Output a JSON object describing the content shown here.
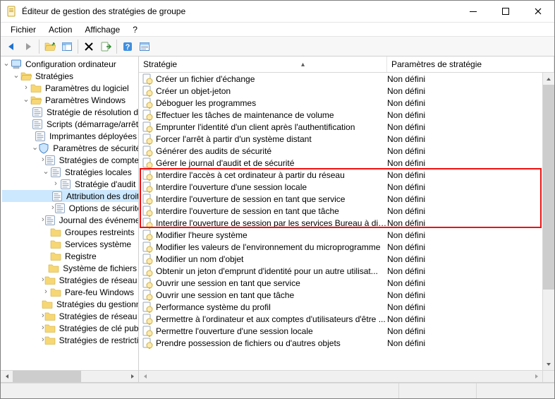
{
  "window": {
    "title": "Éditeur de gestion des stratégies de groupe"
  },
  "menu": {
    "file": "Fichier",
    "action": "Action",
    "view": "Affichage",
    "help": "?"
  },
  "columns": {
    "policy": "Stratégie",
    "setting": "Paramètres de stratégie"
  },
  "tree": {
    "root": {
      "label": "Configuration ordinateur"
    },
    "n1": {
      "label": "Stratégies"
    },
    "n1a": {
      "label": "Paramètres du logiciel"
    },
    "n1b": {
      "label": "Paramètres Windows"
    },
    "n1b1": {
      "label": "Stratégie de résolution de noms"
    },
    "n1b2": {
      "label": "Scripts (démarrage/arrêt)"
    },
    "n1b3": {
      "label": "Imprimantes déployées"
    },
    "n1b4": {
      "label": "Paramètres de sécurité"
    },
    "n1b4a": {
      "label": "Stratégies de comptes"
    },
    "n1b4b": {
      "label": "Stratégies locales"
    },
    "n1b4b1": {
      "label": "Stratégie d'audit"
    },
    "n1b4b2": {
      "label": "Attribution des droits utilisateur"
    },
    "n1b4b3": {
      "label": "Options de sécurité"
    },
    "n1b4c": {
      "label": "Journal des événements"
    },
    "n1b4d": {
      "label": "Groupes restreints"
    },
    "n1b4e": {
      "label": "Services système"
    },
    "n1b4f": {
      "label": "Registre"
    },
    "n1b4g": {
      "label": "Système de fichiers"
    },
    "n1b4h": {
      "label": "Stratégies de réseau filaire"
    },
    "n1b4i": {
      "label": "Pare-feu Windows"
    },
    "n1b4j": {
      "label": "Stratégies du gestionnaire"
    },
    "n1b4k": {
      "label": "Stratégies de réseau sans fil"
    },
    "n1b4l": {
      "label": "Stratégies de clé publique"
    },
    "n1b4m": {
      "label": "Stratégies de restriction logicielle"
    }
  },
  "policies": [
    {
      "name": "Créer un fichier d'échange",
      "state": "Non défini"
    },
    {
      "name": "Créer un objet-jeton",
      "state": "Non défini"
    },
    {
      "name": "Déboguer les programmes",
      "state": "Non défini"
    },
    {
      "name": "Effectuer les tâches de maintenance de volume",
      "state": "Non défini"
    },
    {
      "name": "Emprunter l'identité d'un client après l'authentification",
      "state": "Non défini"
    },
    {
      "name": "Forcer l'arrêt à partir d'un système distant",
      "state": "Non défini"
    },
    {
      "name": "Générer des audits de sécurité",
      "state": "Non défini"
    },
    {
      "name": "Gérer le journal d'audit et de sécurité",
      "state": "Non défini"
    },
    {
      "name": "Interdire l'accès à cet ordinateur à partir du réseau",
      "state": "Non défini"
    },
    {
      "name": "Interdire l'ouverture d'une session locale",
      "state": "Non défini"
    },
    {
      "name": "Interdire l'ouverture de session en tant que service",
      "state": "Non défini"
    },
    {
      "name": "Interdire l'ouverture de session en tant que tâche",
      "state": "Non défini"
    },
    {
      "name": "Interdire l'ouverture de session par les services Bureau à dist...",
      "state": "Non défini"
    },
    {
      "name": "Modifier l'heure système",
      "state": "Non défini"
    },
    {
      "name": "Modifier les valeurs de l'environnement du microprogramme",
      "state": "Non défini"
    },
    {
      "name": "Modifier un nom d'objet",
      "state": "Non défini"
    },
    {
      "name": "Obtenir un jeton d'emprunt d'identité pour un autre utilisat...",
      "state": "Non défini"
    },
    {
      "name": "Ouvrir une session en tant que service",
      "state": "Non défini"
    },
    {
      "name": "Ouvrir une session en tant que tâche",
      "state": "Non défini"
    },
    {
      "name": "Performance système du profil",
      "state": "Non défini"
    },
    {
      "name": "Permettre à l'ordinateur et aux comptes d'utilisateurs d'être ...",
      "state": "Non défini"
    },
    {
      "name": "Permettre l'ouverture d'une session locale",
      "state": "Non défini"
    },
    {
      "name": "Prendre possession de fichiers ou d'autres objets",
      "state": "Non défini"
    }
  ],
  "highlight": {
    "start": 8,
    "end": 12
  }
}
